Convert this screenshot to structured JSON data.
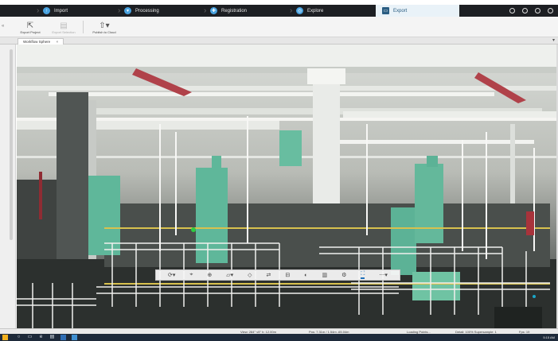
{
  "workflow": {
    "steps": [
      {
        "label": "Import",
        "icon": "cloud-upload-icon"
      },
      {
        "label": "Processing",
        "icon": "funnel-icon"
      },
      {
        "label": "Registration",
        "icon": "puzzle-icon"
      },
      {
        "label": "Explore",
        "icon": "telescope-icon"
      },
      {
        "label": "Export",
        "icon": "monitor-export-icon"
      }
    ],
    "active_step": "Export"
  },
  "ribbon": {
    "buttons": [
      {
        "label": "Export Project",
        "icon": "export-project-icon",
        "enabled": true
      },
      {
        "label": "Export Selection",
        "icon": "export-selection-icon",
        "enabled": false
      },
      {
        "label": "Publish to Cloud",
        "icon": "publish-cloud-icon",
        "enabled": true
      }
    ]
  },
  "document_tab": {
    "label": "Workflow Sphere",
    "close": "×"
  },
  "view_toolbar": {
    "tools": [
      "orbit-icon",
      "measure-icon",
      "zoom-icon",
      "clip-box-icon",
      "section-icon",
      "cad-icon",
      "limit-box-icon",
      "mirror-icon",
      "render-icon",
      "settings-icon",
      "fit-icon",
      "more-icon"
    ],
    "active_tool": "fit-icon"
  },
  "status_bar": {
    "view": "View: 284° v5° h: 12.00m",
    "position": "Pos: 7.31m / 1.54m -65.04m",
    "loading": "Loading Points...",
    "detail": "Detail: 100% Supersample: 1",
    "fps": "Fps: 19"
  },
  "taskbar": {
    "time": "5:15 AM"
  },
  "colors": {
    "accent": "#1d6fb8",
    "workflow_bg": "#1d1f23",
    "equipment_green": "#5fb79a"
  }
}
